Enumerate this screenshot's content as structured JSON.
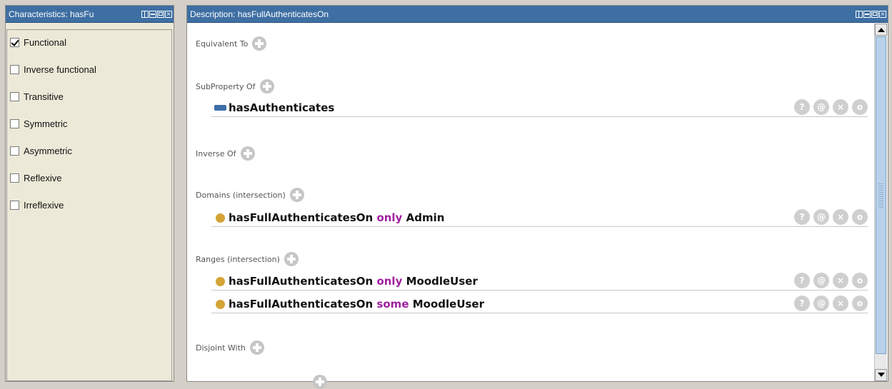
{
  "left_panel": {
    "title": "Characteristics: hasFu",
    "characteristics": [
      {
        "label": "Functional",
        "checked": true
      },
      {
        "label": "Inverse functional",
        "checked": false
      },
      {
        "label": "Transitive",
        "checked": false
      },
      {
        "label": "Symmetric",
        "checked": false
      },
      {
        "label": "Asymmetric",
        "checked": false
      },
      {
        "label": "Reflexive",
        "checked": false
      },
      {
        "label": "Irreflexive",
        "checked": false
      }
    ]
  },
  "right_panel": {
    "title": "Description: hasFullAuthenticatesOn",
    "sections": {
      "equivalent_to": {
        "label": "Equivalent To"
      },
      "subproperty_of": {
        "label": "SubProperty Of",
        "items": [
          {
            "text": "hasAuthenticates"
          }
        ]
      },
      "inverse_of": {
        "label": "Inverse Of"
      },
      "domains": {
        "label": "Domains (intersection)",
        "items": [
          {
            "prop": "hasFullAuthenticatesOn",
            "keyword": "only",
            "cls": "Admin"
          }
        ]
      },
      "ranges": {
        "label": "Ranges (intersection)",
        "items": [
          {
            "prop": "hasFullAuthenticatesOn",
            "keyword": "only",
            "cls": "MoodleUser"
          },
          {
            "prop": "hasFullAuthenticatesOn",
            "keyword": "some",
            "cls": "MoodleUser"
          }
        ]
      },
      "disjoint_with": {
        "label": "Disjoint With"
      }
    },
    "row_actions": {
      "explain": "?",
      "annotate": "@",
      "delete": "×",
      "edit": "o"
    }
  },
  "colors": {
    "titlebar": "#3e6fa3",
    "keyword": "#a020a0",
    "object_property": "#3c6fa8",
    "restriction_dot": "#d4a437"
  }
}
